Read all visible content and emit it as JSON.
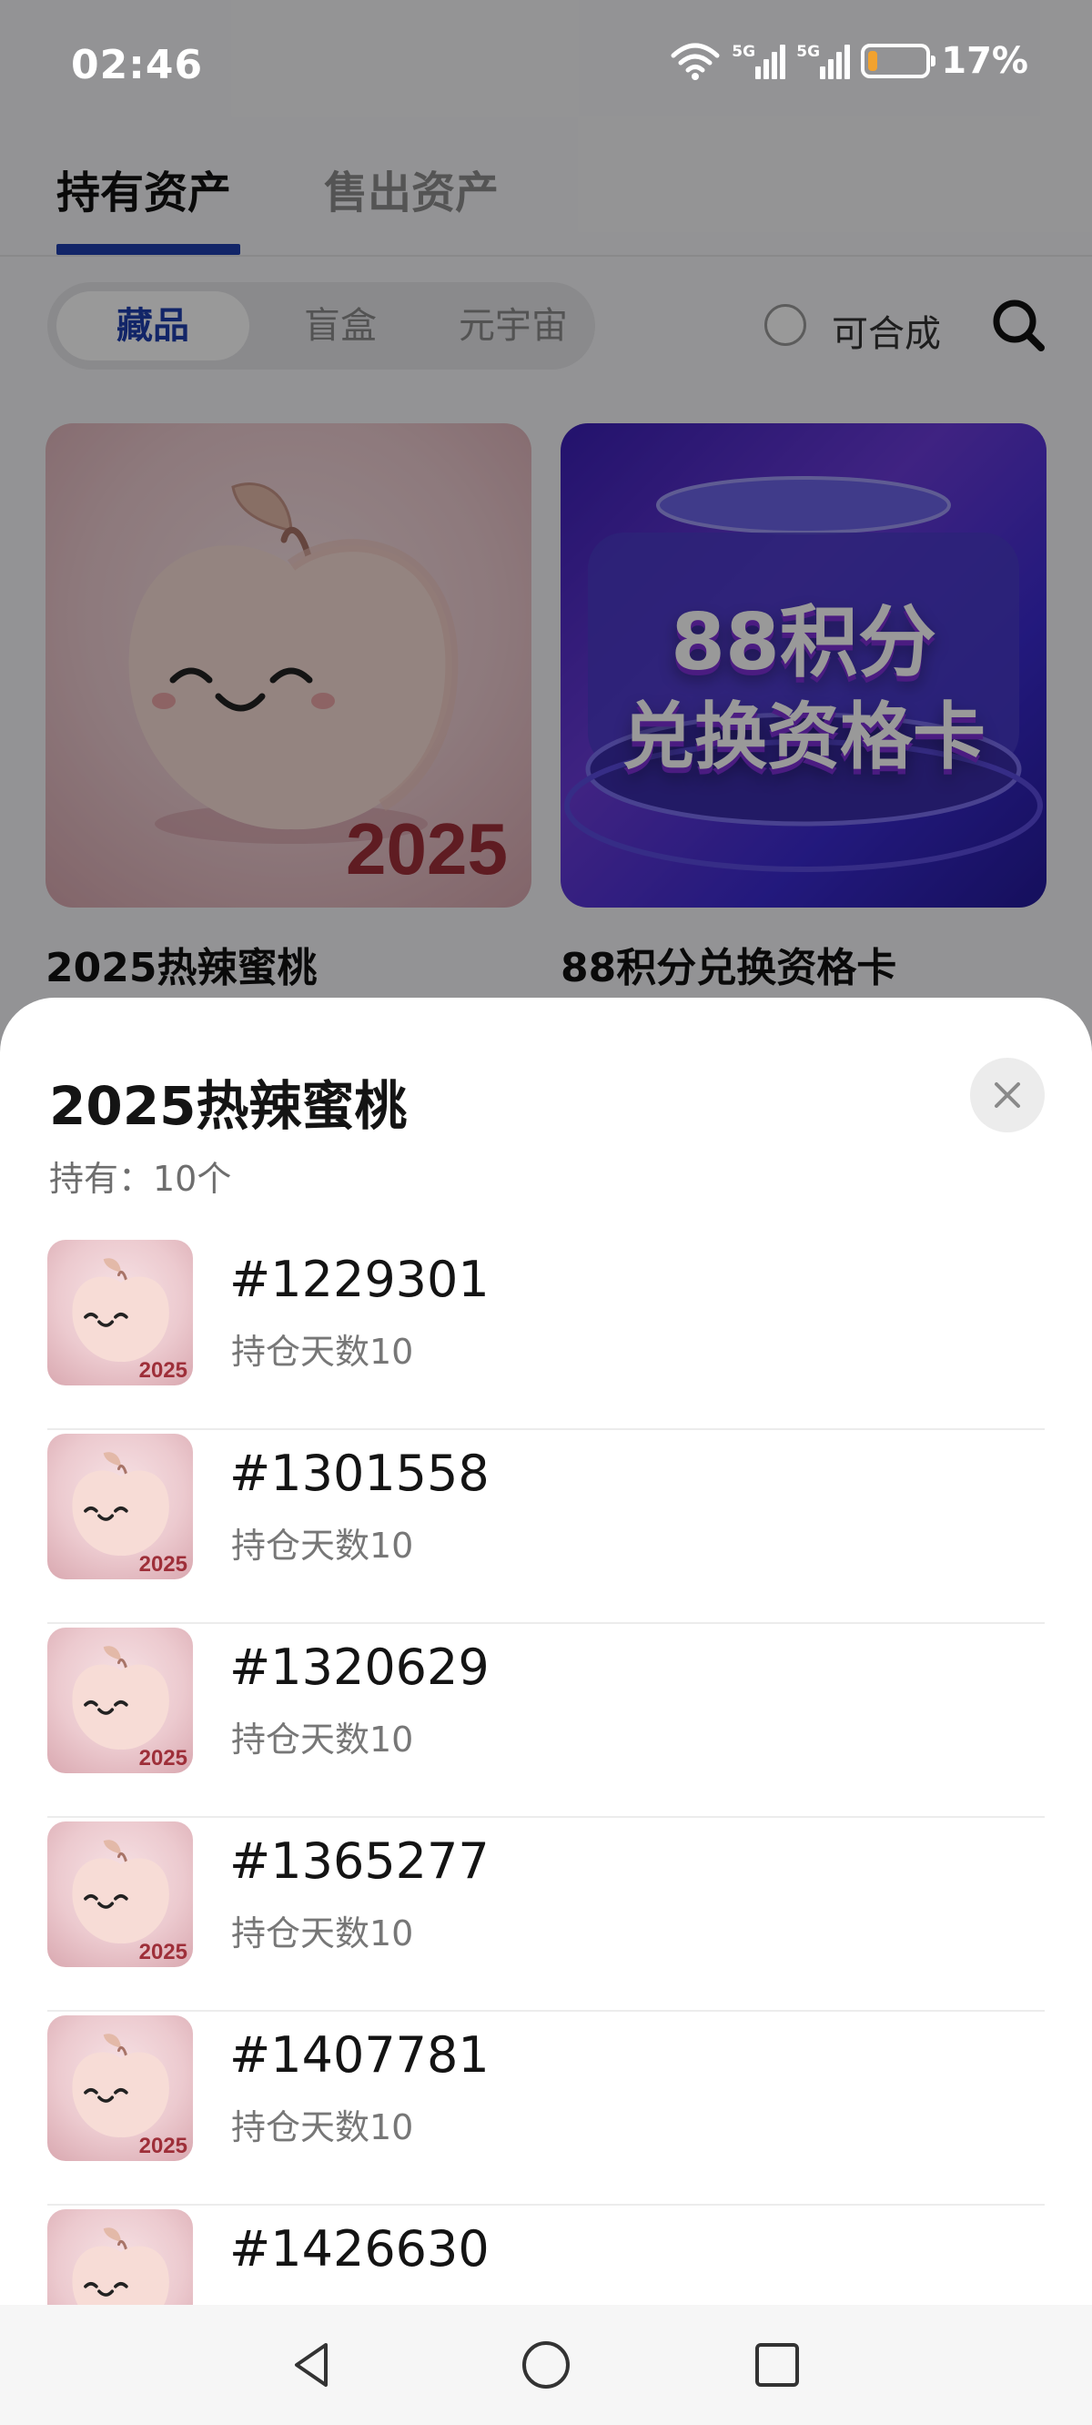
{
  "status_bar": {
    "time": "02:46",
    "signal1_label": "5G",
    "signal2_label": "5G",
    "battery": "17%",
    "battery_level": 0.17,
    "battery_color": "#f2a22e"
  },
  "main_tabs": {
    "held": "持有资产",
    "sold": "售出资产",
    "active_color": "#1e3fae"
  },
  "filters": {
    "segments": [
      "藏品",
      "盲盒",
      "元宇宙"
    ],
    "selected": "藏品",
    "synthesizable_label": "可合成",
    "search_icon": "search-icon"
  },
  "cards": [
    {
      "title": "2025热辣蜜桃",
      "image_text": "2025"
    },
    {
      "title": "88积分兑换资格卡",
      "image_line1": "88积分",
      "image_line2": "兑换资格卡"
    }
  ],
  "sheet": {
    "title": "2025热辣蜜桃",
    "holding": "持有：10个",
    "close_icon": "close-icon",
    "thumb_text": "2025",
    "items": [
      {
        "id": "#1229301",
        "days": "持仓天数10"
      },
      {
        "id": "#1301558",
        "days": "持仓天数10"
      },
      {
        "id": "#1320629",
        "days": "持仓天数10"
      },
      {
        "id": "#1365277",
        "days": "持仓天数10"
      },
      {
        "id": "#1407781",
        "days": "持仓天数10"
      },
      {
        "id": "#1426630",
        "days": ""
      }
    ]
  },
  "nav": [
    "back-icon",
    "home-icon",
    "recents-icon"
  ]
}
